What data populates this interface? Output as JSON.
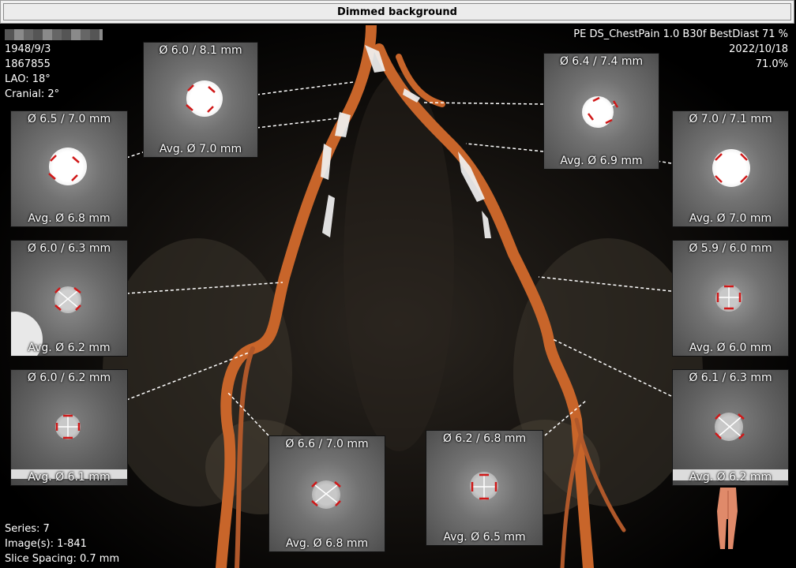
{
  "window": {
    "title_button": "Dimmed background"
  },
  "patient": {
    "dob": "1948/9/3",
    "id": "1867855",
    "lao": "LAO: 18°",
    "cranial": "Cranial: 2°"
  },
  "study": {
    "description": "PE  DS_ChestPain  1.0  B30f  BestDiast 71 %",
    "date": "2022/10/18",
    "phase": "71.0%"
  },
  "series": {
    "series": "Series: 7",
    "images": "Image(s): 1-841",
    "spacing": "Slice Spacing: 0.7 mm"
  },
  "panels": [
    {
      "top": "Ø 6.0 / 8.1 mm",
      "bottom": "Avg. Ø 7.0 mm"
    },
    {
      "top": "Ø 6.5 / 7.0 mm",
      "bottom": "Avg. Ø 6.8 mm"
    },
    {
      "top": "Ø 6.0 / 6.3 mm",
      "bottom": "Avg. Ø 6.2 mm"
    },
    {
      "top": "Ø 6.0 / 6.2 mm",
      "bottom": "Avg. Ø 6.1 mm"
    },
    {
      "top": "Ø 6.6 / 7.0 mm",
      "bottom": "Avg. Ø 6.8 mm"
    },
    {
      "top": "Ø 6.2 / 6.8 mm",
      "bottom": "Avg. Ø 6.5 mm"
    },
    {
      "top": "Ø 6.4 / 7.4 mm",
      "bottom": "Avg. Ø 6.9 mm"
    },
    {
      "top": "Ø 7.0 / 7.1 mm",
      "bottom": "Avg. Ø 7.0 mm"
    },
    {
      "top": "Ø 5.9 / 6.0 mm",
      "bottom": "Avg. Ø 6.0 mm"
    },
    {
      "top": "Ø 6.1 / 6.3 mm",
      "bottom": "Avg. Ø 6.2 mm"
    }
  ],
  "colors": {
    "vessel": "#c8652a",
    "caliper": "#d01818",
    "connector": "#ffffff"
  },
  "icons": {
    "orientation": "body-orientation-icon"
  }
}
